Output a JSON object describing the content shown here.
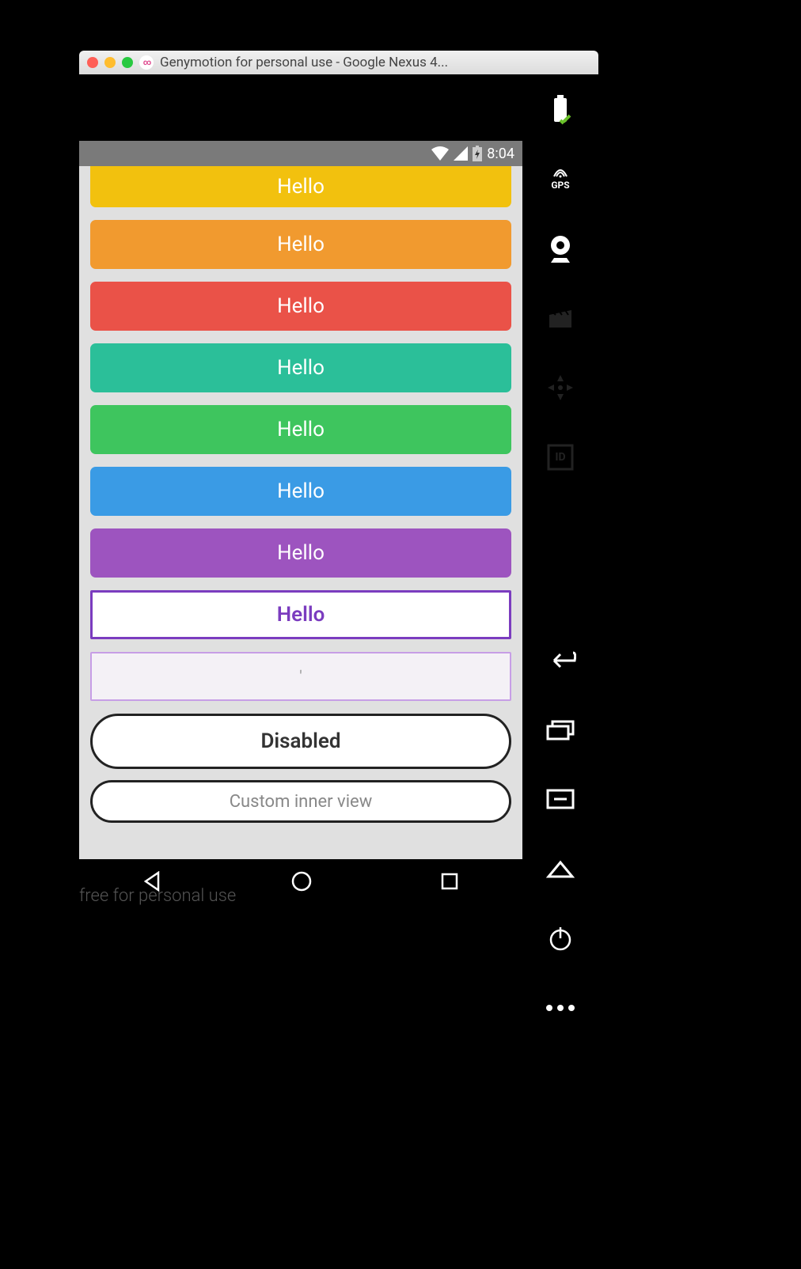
{
  "window": {
    "title": "Genymotion for personal use - Google Nexus 4..."
  },
  "status_bar": {
    "time": "8:04"
  },
  "buttons": [
    {
      "label": "Hello",
      "bg": "#f2c10e"
    },
    {
      "label": "Hello",
      "bg": "#f19a2f"
    },
    {
      "label": "Hello",
      "bg": "#ea5248"
    },
    {
      "label": "Hello",
      "bg": "#2bbf99"
    },
    {
      "label": "Hello",
      "bg": "#3ec55e"
    },
    {
      "label": "Hello",
      "bg": "#3a9be5"
    },
    {
      "label": "Hello",
      "bg": "#9d54bf"
    }
  ],
  "outline_button": {
    "label": "Hello"
  },
  "light_outline_button": {
    "label": "'"
  },
  "disabled_button": {
    "label": "Disabled"
  },
  "custom_button": {
    "label": "Custom inner view"
  },
  "watermark": "free for personal use",
  "sidebar": {
    "gps_label": "GPS",
    "id_label": "ID"
  }
}
